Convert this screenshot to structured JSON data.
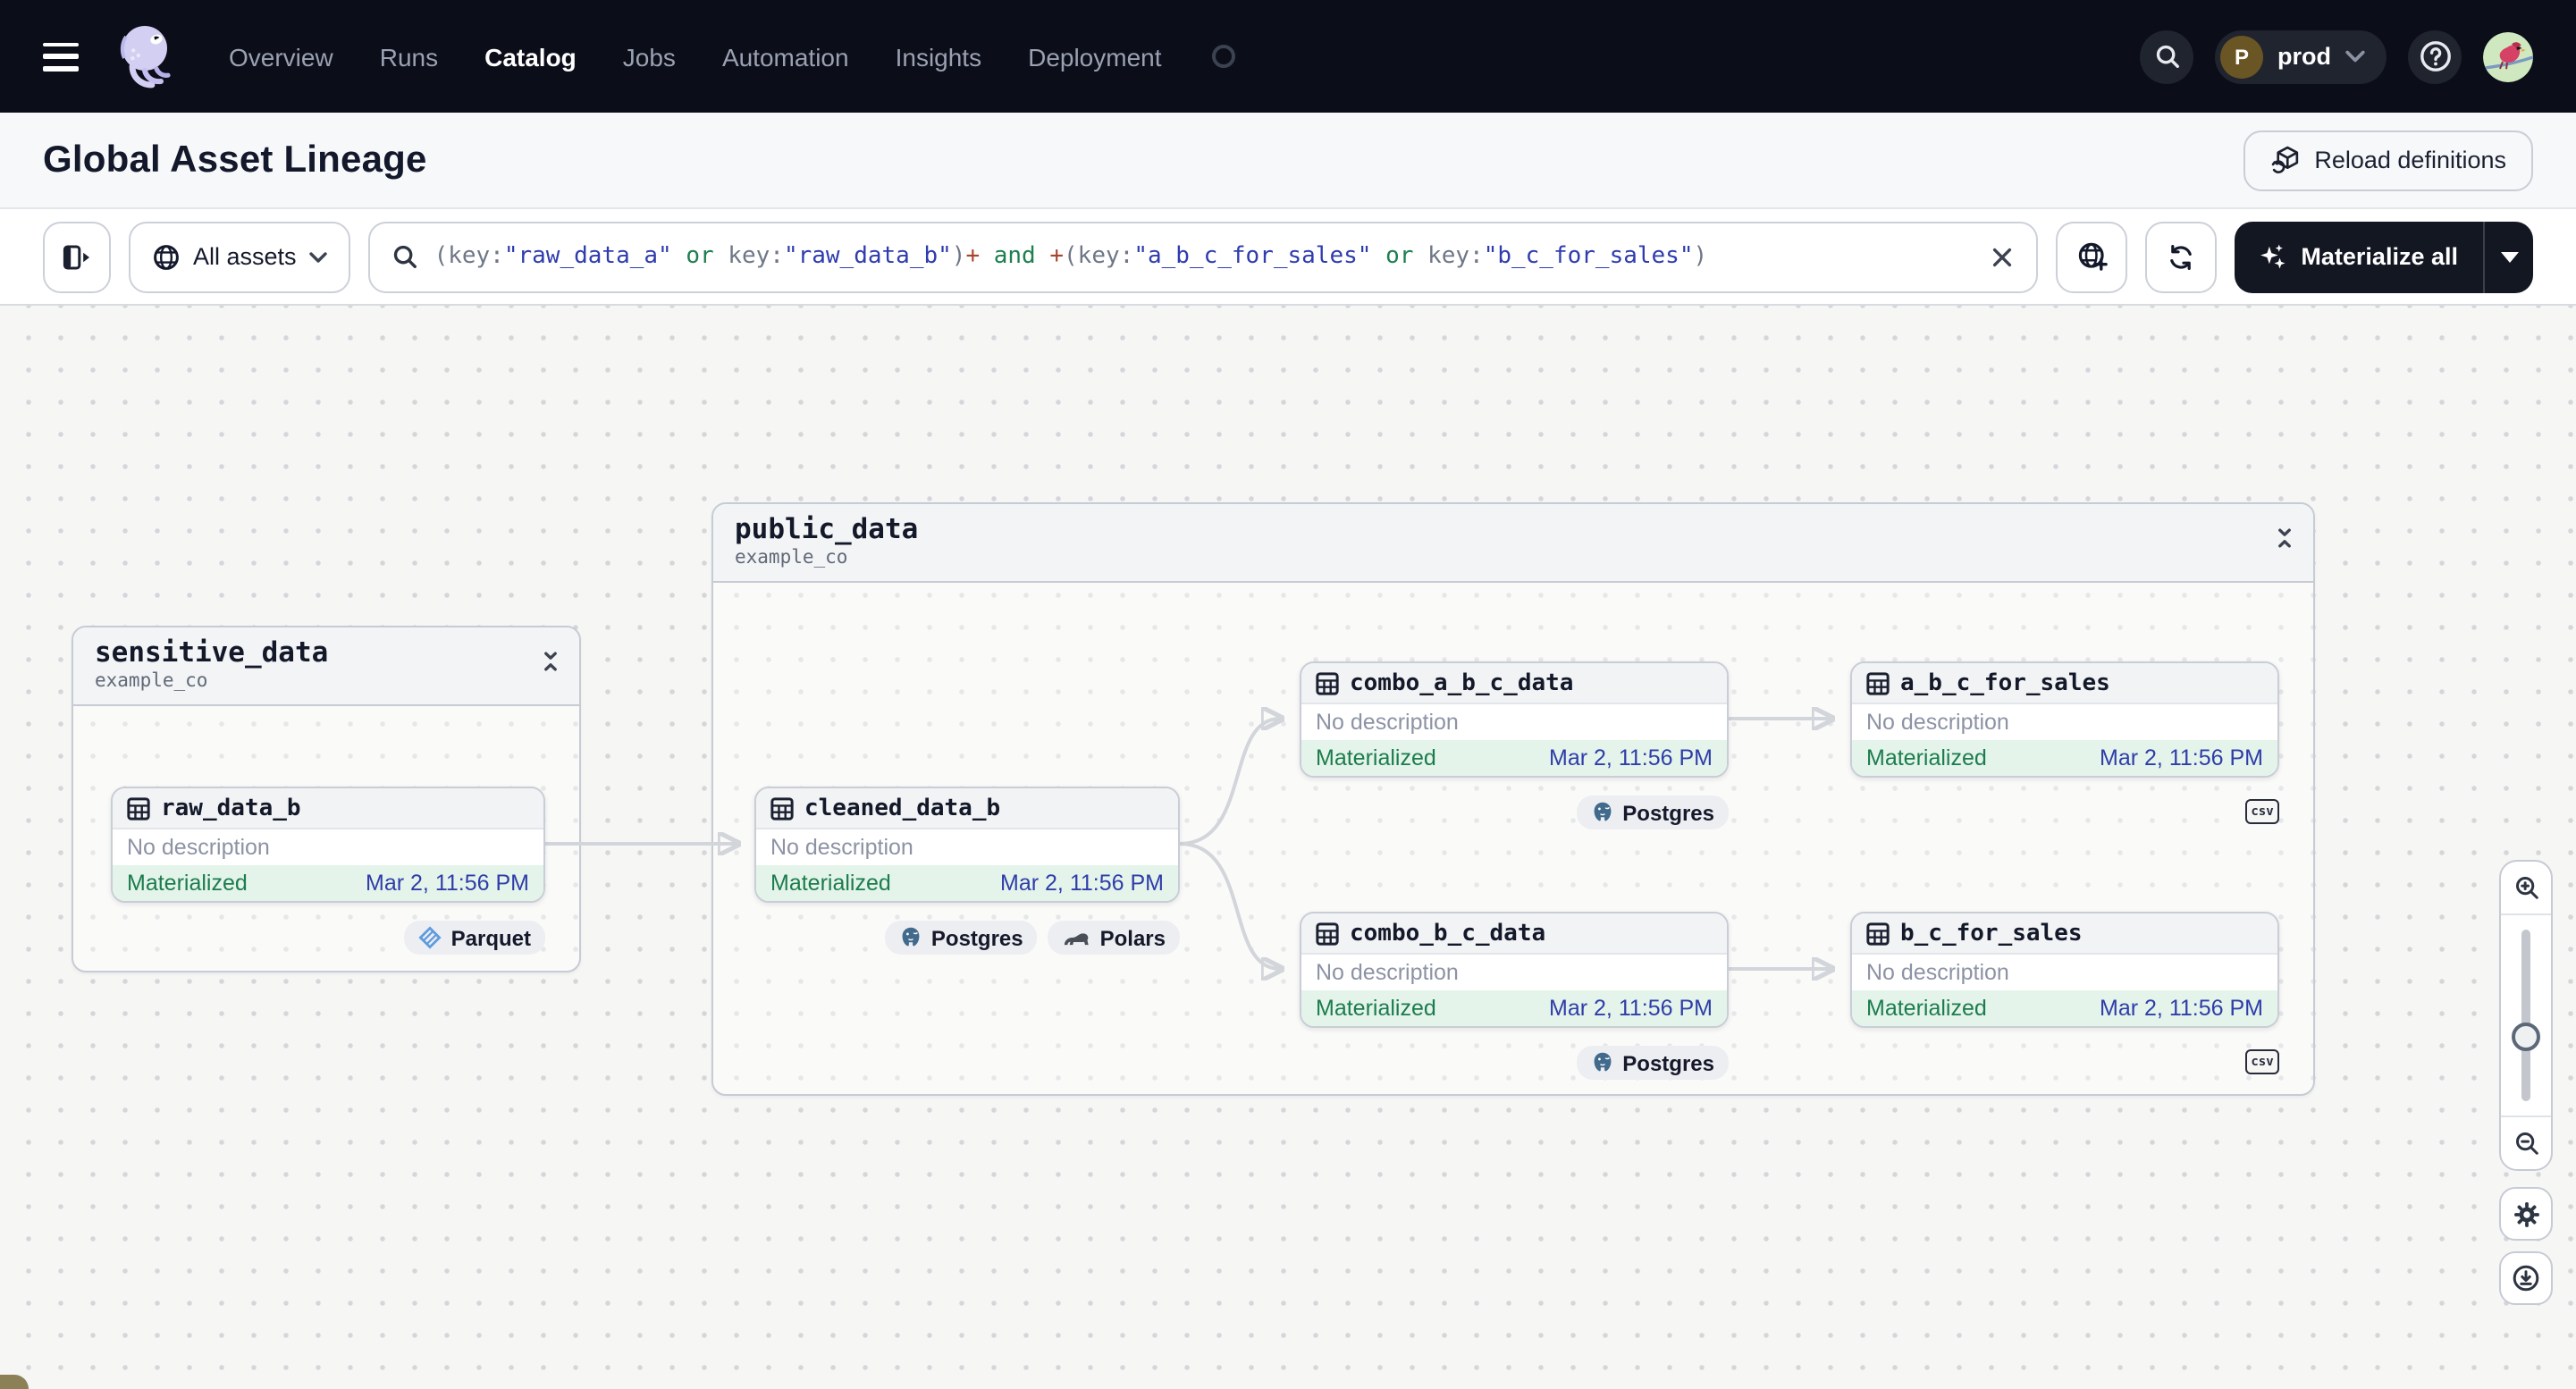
{
  "nav": {
    "items": [
      "Overview",
      "Runs",
      "Catalog",
      "Jobs",
      "Automation",
      "Insights",
      "Deployment"
    ],
    "active_item": "Catalog",
    "environment": {
      "initial": "P",
      "name": "prod"
    }
  },
  "page_header": {
    "title": "Global Asset Lineage",
    "reload_button": "Reload definitions"
  },
  "toolbar": {
    "scope_selector": "All assets",
    "search": {
      "query": "(key:\"raw_data_a\" or key:\"raw_data_b\")+ and +(key:\"a_b_c_for_sales\" or key:\"b_c_for_sales\")",
      "segments": [
        {
          "text": "(key:",
          "type": "punct"
        },
        {
          "text": "\"raw_data_a\"",
          "type": "string"
        },
        {
          "text": " or ",
          "type": "op"
        },
        {
          "text": "key:",
          "type": "punct"
        },
        {
          "text": "\"raw_data_b\"",
          "type": "string"
        },
        {
          "text": ")",
          "type": "punct"
        },
        {
          "text": "+",
          "type": "plus"
        },
        {
          "text": " and ",
          "type": "op"
        },
        {
          "text": "+",
          "type": "plus"
        },
        {
          "text": "(key:",
          "type": "punct"
        },
        {
          "text": "\"a_b_c_for_sales\"",
          "type": "string"
        },
        {
          "text": " or ",
          "type": "op"
        },
        {
          "text": "key:",
          "type": "punct"
        },
        {
          "text": "\"b_c_for_sales\"",
          "type": "string"
        },
        {
          "text": ")",
          "type": "punct"
        }
      ]
    },
    "materialize_button": "Materialize all"
  },
  "graph": {
    "groups": [
      {
        "name": "sensitive_data",
        "location": "example_co"
      },
      {
        "name": "public_data",
        "location": "example_co"
      }
    ],
    "nodes": [
      {
        "name": "raw_data_b",
        "description": "No description",
        "status": "Materialized",
        "timestamp": "Mar 2, 11:56 PM",
        "badges": [
          {
            "label": "Parquet",
            "icon": "parquet-icon"
          }
        ]
      },
      {
        "name": "cleaned_data_b",
        "description": "No description",
        "status": "Materialized",
        "timestamp": "Mar 2, 11:56 PM",
        "badges": [
          {
            "label": "Postgres",
            "icon": "postgres-icon"
          },
          {
            "label": "Polars",
            "icon": "polars-icon"
          }
        ]
      },
      {
        "name": "combo_a_b_c_data",
        "description": "No description",
        "status": "Materialized",
        "timestamp": "Mar 2, 11:56 PM",
        "badges": [
          {
            "label": "Postgres",
            "icon": "postgres-icon"
          }
        ]
      },
      {
        "name": "a_b_c_for_sales",
        "description": "No description",
        "status": "Materialized",
        "timestamp": "Mar 2, 11:56 PM",
        "badges": [
          {
            "label": "csv",
            "icon": "csv-icon"
          }
        ]
      },
      {
        "name": "combo_b_c_data",
        "description": "No description",
        "status": "Materialized",
        "timestamp": "Mar 2, 11:56 PM",
        "badges": [
          {
            "label": "Postgres",
            "icon": "postgres-icon"
          }
        ]
      },
      {
        "name": "b_c_for_sales",
        "description": "No description",
        "status": "Materialized",
        "timestamp": "Mar 2, 11:56 PM",
        "badges": [
          {
            "label": "csv",
            "icon": "csv-icon"
          }
        ]
      }
    ],
    "edges": [
      {
        "from": "raw_data_b",
        "to": "cleaned_data_b"
      },
      {
        "from": "cleaned_data_b",
        "to": "combo_a_b_c_data"
      },
      {
        "from": "cleaned_data_b",
        "to": "combo_b_c_data"
      },
      {
        "from": "combo_a_b_c_data",
        "to": "a_b_c_for_sales"
      },
      {
        "from": "combo_b_c_data",
        "to": "b_c_for_sales"
      }
    ]
  },
  "colors": {
    "nav_bg": "#0b0d19",
    "materialized_text": "#1c7c4d",
    "materialized_bg": "#e4f4ea",
    "timestamp_blue": "#2f3da9",
    "query_string": "#2f3cae",
    "query_operator": "#1e7f4f",
    "query_plus": "#a8442c",
    "edge_gray": "#d2d5da",
    "dark_button": "#131722"
  }
}
